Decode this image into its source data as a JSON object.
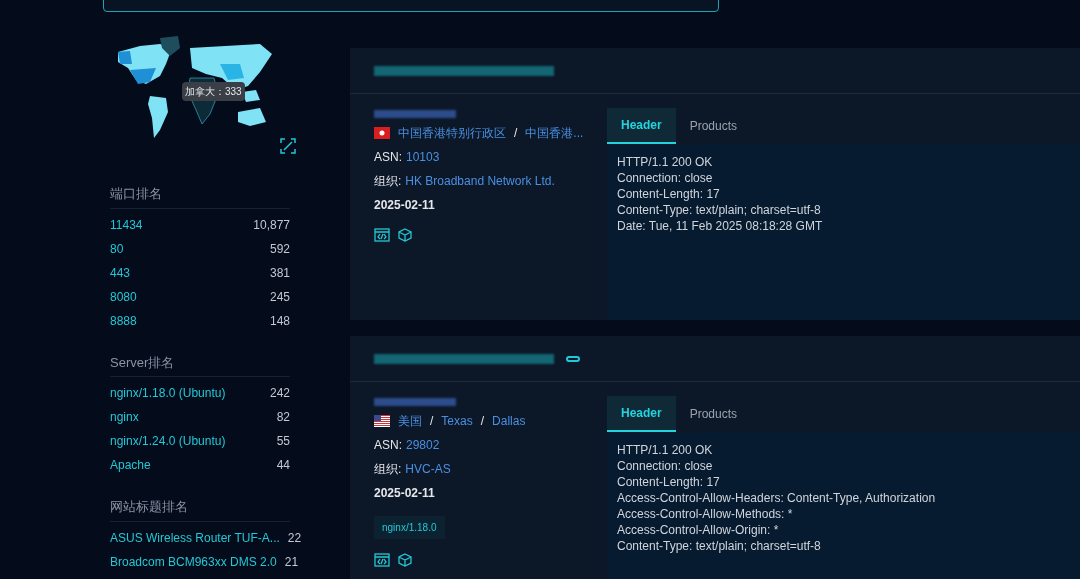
{
  "map": {
    "tooltip": "加拿大：333"
  },
  "rankings": [
    {
      "title": "端口排名",
      "items": [
        {
          "label": "11434",
          "count": "10,877"
        },
        {
          "label": "80",
          "count": "592"
        },
        {
          "label": "443",
          "count": "381"
        },
        {
          "label": "8080",
          "count": "245"
        },
        {
          "label": "8888",
          "count": "148"
        }
      ]
    },
    {
      "title": "Server排名",
      "items": [
        {
          "label": "nginx/1.18.0 (Ubuntu)",
          "count": "242"
        },
        {
          "label": "nginx",
          "count": "82"
        },
        {
          "label": "nginx/1.24.0 (Ubuntu)",
          "count": "55"
        },
        {
          "label": "Apache",
          "count": "44"
        }
      ]
    },
    {
      "title": "网站标题排名",
      "items": [
        {
          "label": "ASUS Wireless Router TUF-A...",
          "count": "22"
        },
        {
          "label": "Broadcom BCM963xx DMS 2.0",
          "count": "21"
        }
      ]
    }
  ],
  "results": [
    {
      "has_link": false,
      "flag": {
        "kind": "hk"
      },
      "location_separator": "/",
      "location": [
        "中国香港特别行政区",
        "中国香港..."
      ],
      "asn_label": "ASN:",
      "asn": "10103",
      "org_label": "组织:",
      "org": "HK Broadband Network Ltd.",
      "date": "2025-02-11",
      "tabs": [
        {
          "label": "Header",
          "selected": true
        },
        {
          "label": "Products",
          "selected": false
        }
      ],
      "header_lines": [
        "HTTP/1.1 200 OK",
        "Connection: close",
        "Content-Length: 17",
        "Content-Type: text/plain; charset=utf-8",
        "Date: Tue, 11 Feb 2025 08:18:28 GMT"
      ]
    },
    {
      "has_link": true,
      "flag": {
        "kind": "us"
      },
      "location_separator": "/",
      "location": [
        "美国",
        "Texas",
        "Dallas"
      ],
      "asn_label": "ASN:",
      "asn": "29802",
      "org_label": "组织:",
      "org": "HVC-AS",
      "date": "2025-02-11",
      "tags": [
        "nginx/1.18.0"
      ],
      "tabs": [
        {
          "label": "Header",
          "selected": true
        },
        {
          "label": "Products",
          "selected": false
        }
      ],
      "header_lines": [
        "HTTP/1.1 200 OK",
        "Connection: close",
        "Content-Length: 17",
        "Access-Control-Allow-Headers: Content-Type, Authorization",
        "Access-Control-Allow-Methods: *",
        "Access-Control-Allow-Origin: *",
        "Content-Type: text/plain; charset=utf-8"
      ]
    }
  ]
}
